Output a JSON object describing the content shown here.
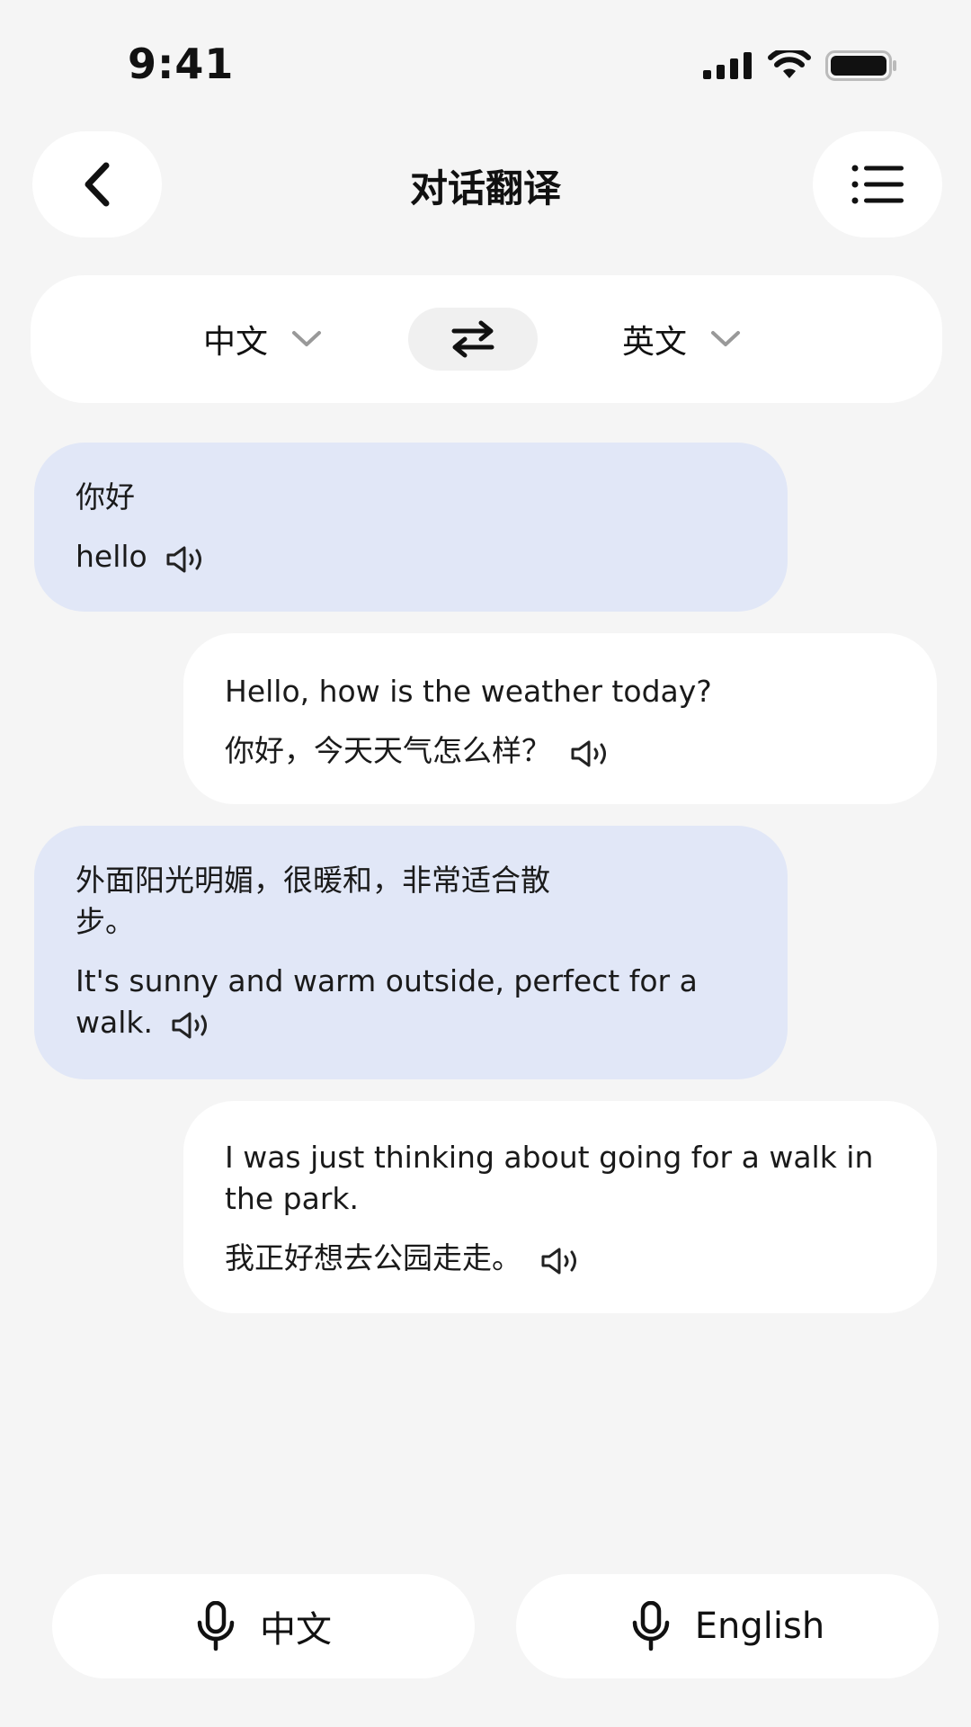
{
  "status_bar": {
    "time": "9:41"
  },
  "header": {
    "title": "对话翻译"
  },
  "language_bar": {
    "source": "中文",
    "target": "英文"
  },
  "messages": [
    {
      "side": "left",
      "source": "你好",
      "translation": "hello"
    },
    {
      "side": "right",
      "source": "Hello, how is the weather today?",
      "translation": "你好，今天天气怎么样？"
    },
    {
      "side": "left",
      "source": "外面阳光明媚，很暖和，非常适合散步。",
      "translation": "It's sunny and warm outside, perfect for a walk."
    },
    {
      "side": "right",
      "source": "I was just thinking about going for a walk in the park.",
      "translation": "我正好想去公园走走。"
    }
  ],
  "bottom": {
    "mic_left_label": "中文",
    "mic_right_label": "English"
  },
  "colors": {
    "background": "#f5f5f5",
    "left_bubble": "#e1e7f7",
    "right_bubble": "#ffffff",
    "text": "#1a1a1a"
  },
  "icons": {
    "back": "chevron-left-icon",
    "menu": "list-icon",
    "swap": "swap-arrows-icon",
    "dropdown": "chevron-down-icon",
    "speaker": "speaker-icon",
    "mic": "microphone-icon"
  }
}
